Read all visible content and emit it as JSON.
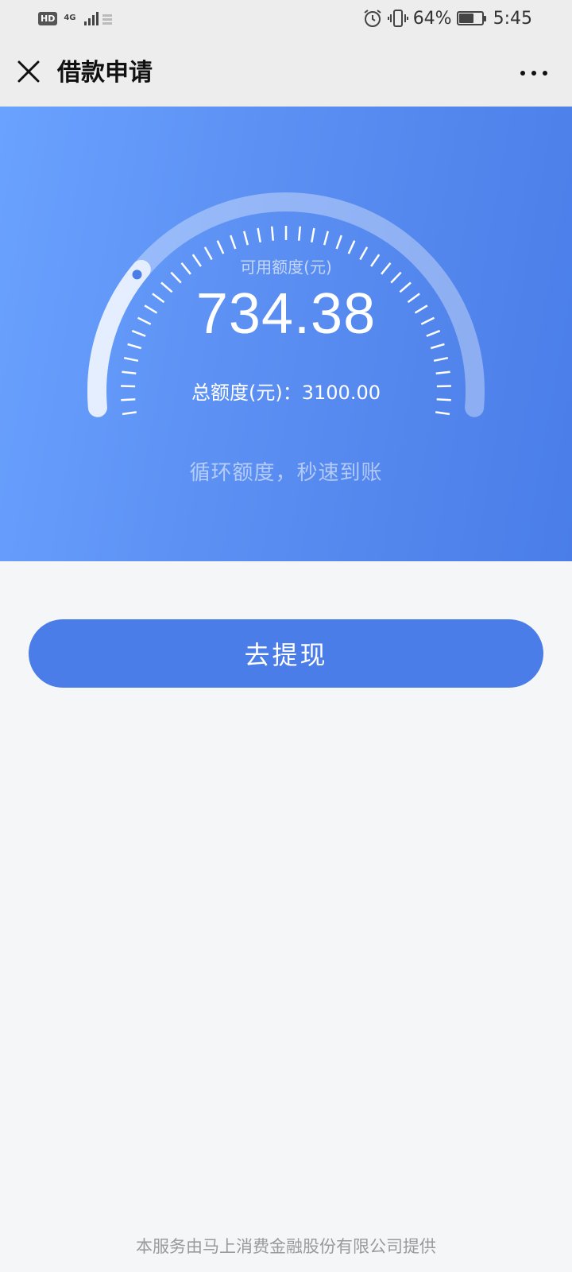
{
  "status_bar": {
    "hd_badge": "HD",
    "network": "4G",
    "battery_percent": "64%",
    "battery_level": 0.64,
    "time": "5:45",
    "icons": [
      "signal-icon",
      "alarm-icon",
      "vibrate-icon",
      "battery-icon"
    ]
  },
  "nav": {
    "title": "借款申请",
    "close_icon": "close-icon",
    "more_icon": "more-icon"
  },
  "credit": {
    "available_label": "可用额度(元)",
    "available_value": "734.38",
    "total_label": "总额度(元)：",
    "total_value": "3100.00",
    "used_fraction": 0.237,
    "slogan": "循环额度，秒速到账"
  },
  "actions": {
    "withdraw_label": "去提现"
  },
  "footer": {
    "text": "本服务由马上消费金融股份有限公司提供"
  },
  "colors": {
    "primary": "#4a7de8",
    "hero_start": "#6aa2ff",
    "hero_end": "#4a7de8",
    "bar_bg": "#ededed",
    "page_bg": "#f5f6f8"
  }
}
